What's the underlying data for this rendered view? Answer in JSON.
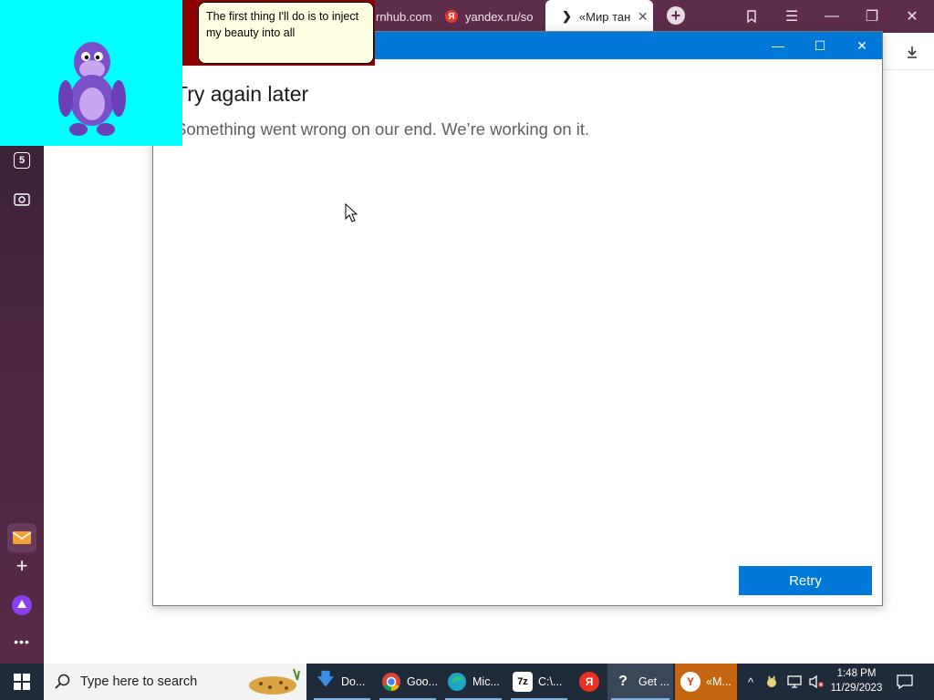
{
  "browser": {
    "tabs": [
      {
        "label": "rnhub.com",
        "active": false
      },
      {
        "label": "yandex.ru/so",
        "active": false
      },
      {
        "label": "«Мир тан",
        "active": true
      }
    ],
    "new_tab_symbol": "+",
    "icons": [
      "bookmarks-icon",
      "menu-icon",
      "minimize-icon",
      "restore-icon",
      "close-icon",
      "download-icon"
    ],
    "colors": {
      "tabbar": "#5e2d4b",
      "sidebar": "#4b2643"
    }
  },
  "sidebar": {
    "tab_count": "5",
    "icons": [
      "tabs-count-icon",
      "screenshot-icon",
      "mail-icon",
      "add-icon",
      "alice-icon",
      "more-icon"
    ]
  },
  "assistant": {
    "speech": "The first thing I'll do is to inject my beauty into all",
    "background": "#00ffff"
  },
  "app_window": {
    "title": "",
    "heading": "Try again later",
    "message": "Something went wrong on our end. We’re working on it.",
    "retry_label": "Retry",
    "accent": "#0078d7"
  },
  "taskbar": {
    "search_placeholder": "Type here to search",
    "apps": [
      {
        "label": "Do...",
        "icon": "download-arrow-icon"
      },
      {
        "label": "Goo...",
        "icon": "chrome-icon"
      },
      {
        "label": "Mic...",
        "icon": "edge-icon"
      },
      {
        "label": "C:\\...",
        "icon": "7zip-icon"
      },
      {
        "label": "",
        "icon": "yandex-icon"
      },
      {
        "label": "Get ...",
        "icon": "get-help-icon"
      },
      {
        "label": "«M...",
        "icon": "yandex-browser-icon"
      }
    ],
    "time": "1:48 PM",
    "date": "11/29/2023"
  }
}
